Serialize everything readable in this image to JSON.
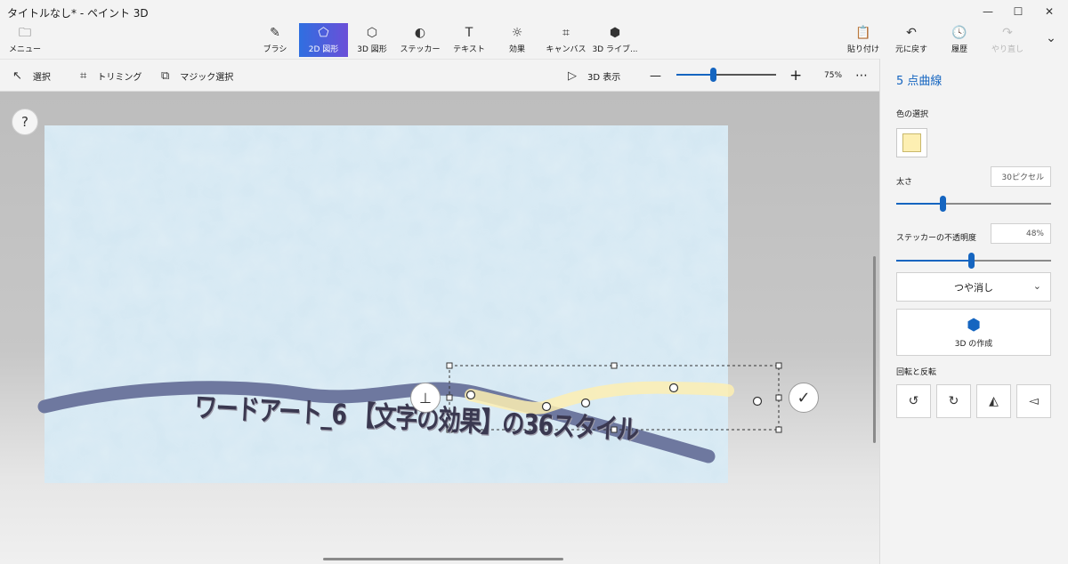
{
  "window": {
    "title": "タイトルなし* - ペイント 3D",
    "minimize_glyph": "—",
    "maximize_glyph": "☐",
    "close_glyph": "✕"
  },
  "menu": {
    "label": "メニュー",
    "icon": "folder-icon",
    "glyph": "🗀"
  },
  "tools": [
    {
      "label": "ブラシ",
      "icon": "brush-icon",
      "glyph": "✎"
    },
    {
      "label": "2D 図形",
      "icon": "2d-shapes-icon",
      "glyph": "⬠"
    },
    {
      "label": "3D 図形",
      "icon": "3d-shapes-icon",
      "glyph": "⬡"
    },
    {
      "label": "ステッカー",
      "icon": "sticker-icon",
      "glyph": "◐"
    },
    {
      "label": "テキスト",
      "icon": "text-icon",
      "glyph": "T"
    },
    {
      "label": "効果",
      "icon": "effects-icon",
      "glyph": "☼"
    },
    {
      "label": "キャンバス",
      "icon": "canvas-icon",
      "glyph": "⌗"
    },
    {
      "label": "3D ライブ...",
      "icon": "3d-library-icon",
      "glyph": "⬢"
    }
  ],
  "actions": [
    {
      "label": "貼り付け",
      "icon": "paste-icon",
      "glyph": "📋"
    },
    {
      "label": "元に戻す",
      "icon": "undo-icon",
      "glyph": "↶"
    },
    {
      "label": "履歴",
      "icon": "history-icon",
      "glyph": "🕓"
    },
    {
      "label": "やり直し",
      "icon": "redo-icon",
      "glyph": "↷"
    },
    {
      "label": "",
      "icon": "expand-icon",
      "glyph": "⌄"
    }
  ],
  "subbar": {
    "select": {
      "label": "選択",
      "glyph": "↖"
    },
    "crop": {
      "label": "トリミング",
      "glyph": "⌗"
    },
    "magic": {
      "label": "マジック選択",
      "glyph": "⧉"
    },
    "view3d": {
      "label": "3D 表示",
      "glyph": "▷"
    },
    "zoom_out": "—",
    "zoom_in": "+",
    "zoom": "75%",
    "more": "⋯"
  },
  "workspace": {
    "help": "?"
  },
  "canvas": {
    "wordart": "ワードアート_6 【文字の効果】の36スタイル",
    "stamp_glyph": "⊥",
    "confirm_glyph": "✓"
  },
  "panel": {
    "title": "5 点曲線",
    "color_label": "色の選択",
    "color": "#fdefb2",
    "thickness_label": "太さ",
    "thickness_value": "30ピクセル",
    "thickness_fraction": 0.3,
    "opacity_label": "ステッカーの不透明度",
    "opacity_value": "48%",
    "opacity_fraction": 0.48,
    "finish": "つや消し",
    "finish_chevron": "⌄",
    "make3d": "3D の作成",
    "make3d_glyph": "⬢",
    "rotate_label": "回転と反転",
    "rotate_buttons": [
      {
        "icon": "rotate-left-icon",
        "glyph": "↺"
      },
      {
        "icon": "rotate-right-icon",
        "glyph": "↻"
      },
      {
        "icon": "flip-horizontal-icon",
        "glyph": "◭"
      },
      {
        "icon": "flip-vertical-icon",
        "glyph": "◅"
      }
    ]
  }
}
